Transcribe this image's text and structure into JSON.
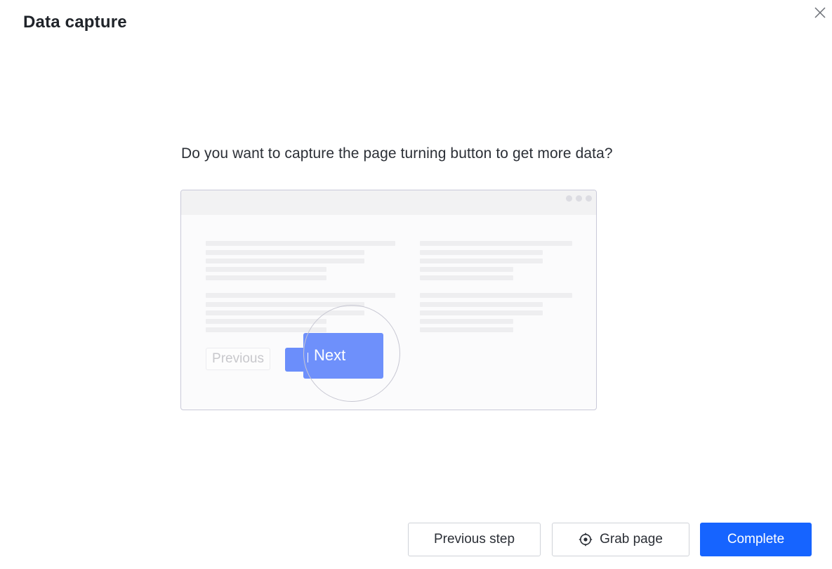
{
  "dialog": {
    "title": "Data capture",
    "close_icon": "close-icon"
  },
  "main": {
    "question": "Do you want to capture the page turning button to get more data?"
  },
  "illustration": {
    "previous_label": "Previous",
    "next_label": "Next"
  },
  "footer": {
    "previous_step_label": "Previous step",
    "grab_page_label": "Grab page",
    "grab_page_icon": "target-icon",
    "complete_label": "Complete"
  },
  "colors": {
    "accent": "#1664ff",
    "illustration_button": "#6e90fb"
  }
}
